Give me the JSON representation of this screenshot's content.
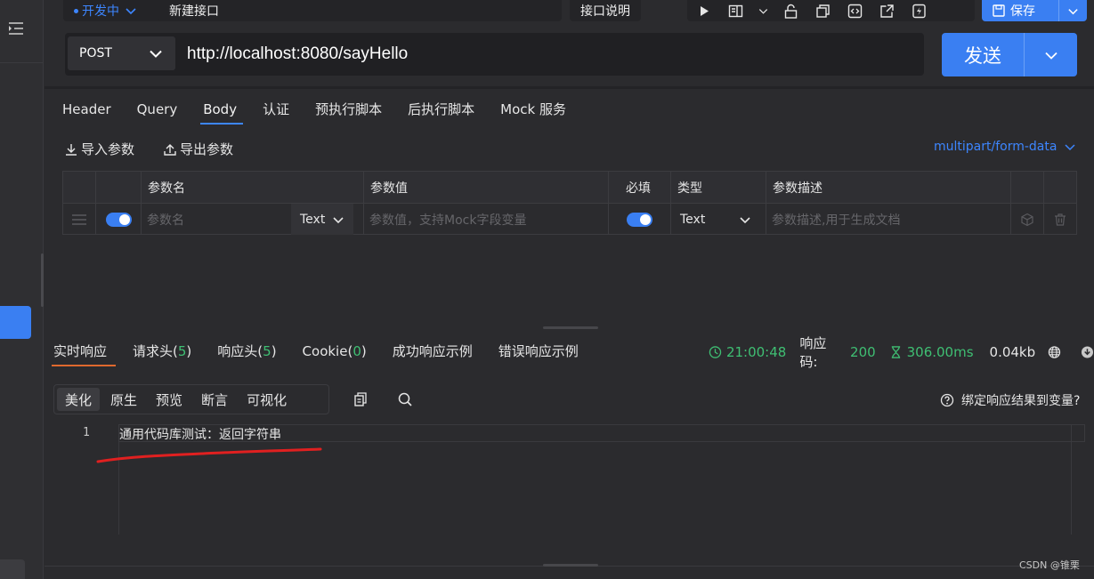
{
  "env": {
    "label": "开发中"
  },
  "api_name": "新建接口",
  "doc_button": "接口说明",
  "save_button": "保存",
  "request": {
    "method": "POST",
    "url": "http://localhost:8080/sayHello",
    "send_label": "发送"
  },
  "request_tabs": [
    "Header",
    "Query",
    "Body",
    "认证",
    "预执行脚本",
    "后执行脚本",
    "Mock 服务"
  ],
  "active_request_tab": "Body",
  "param_actions": {
    "import": "导入参数",
    "export": "导出参数"
  },
  "content_type": "multipart/form-data",
  "params_table": {
    "headers": [
      "参数名",
      "参数值",
      "必填",
      "类型",
      "参数描述"
    ],
    "row": {
      "enabled": true,
      "name_placeholder": "参数名",
      "name_type": "Text",
      "value_placeholder": "参数值，支持Mock字段变量",
      "required": true,
      "type": "Text",
      "desc_placeholder": "参数描述,用于生成文档"
    }
  },
  "response_tabs": [
    {
      "label": "实时响应",
      "count": ""
    },
    {
      "label": "请求头(",
      "count": "5",
      "suffix": ")"
    },
    {
      "label": "响应头(",
      "count": "5",
      "suffix": ")"
    },
    {
      "label": "Cookie(",
      "count": "0",
      "suffix": ")"
    },
    {
      "label": "成功响应示例",
      "count": ""
    },
    {
      "label": "错误响应示例",
      "count": ""
    }
  ],
  "response_meta": {
    "time": "21:00:48",
    "code_label": "响应码:",
    "code": "200",
    "duration": "306.00ms",
    "size": "0.04kb"
  },
  "view_modes": [
    "美化",
    "原生",
    "预览",
    "断言",
    "可视化"
  ],
  "active_view_mode": "美化",
  "bind_help": "绑定响应结果到变量?",
  "editor": {
    "line_number": "1",
    "content": "通用代码库测试：返回字符串"
  },
  "watermark": "CSDN @锥栗",
  "colors": {
    "accent": "#3a7ff2",
    "success": "#3fbf73",
    "active_tab_underline": "#e0692e",
    "annotation": "#e02020"
  }
}
